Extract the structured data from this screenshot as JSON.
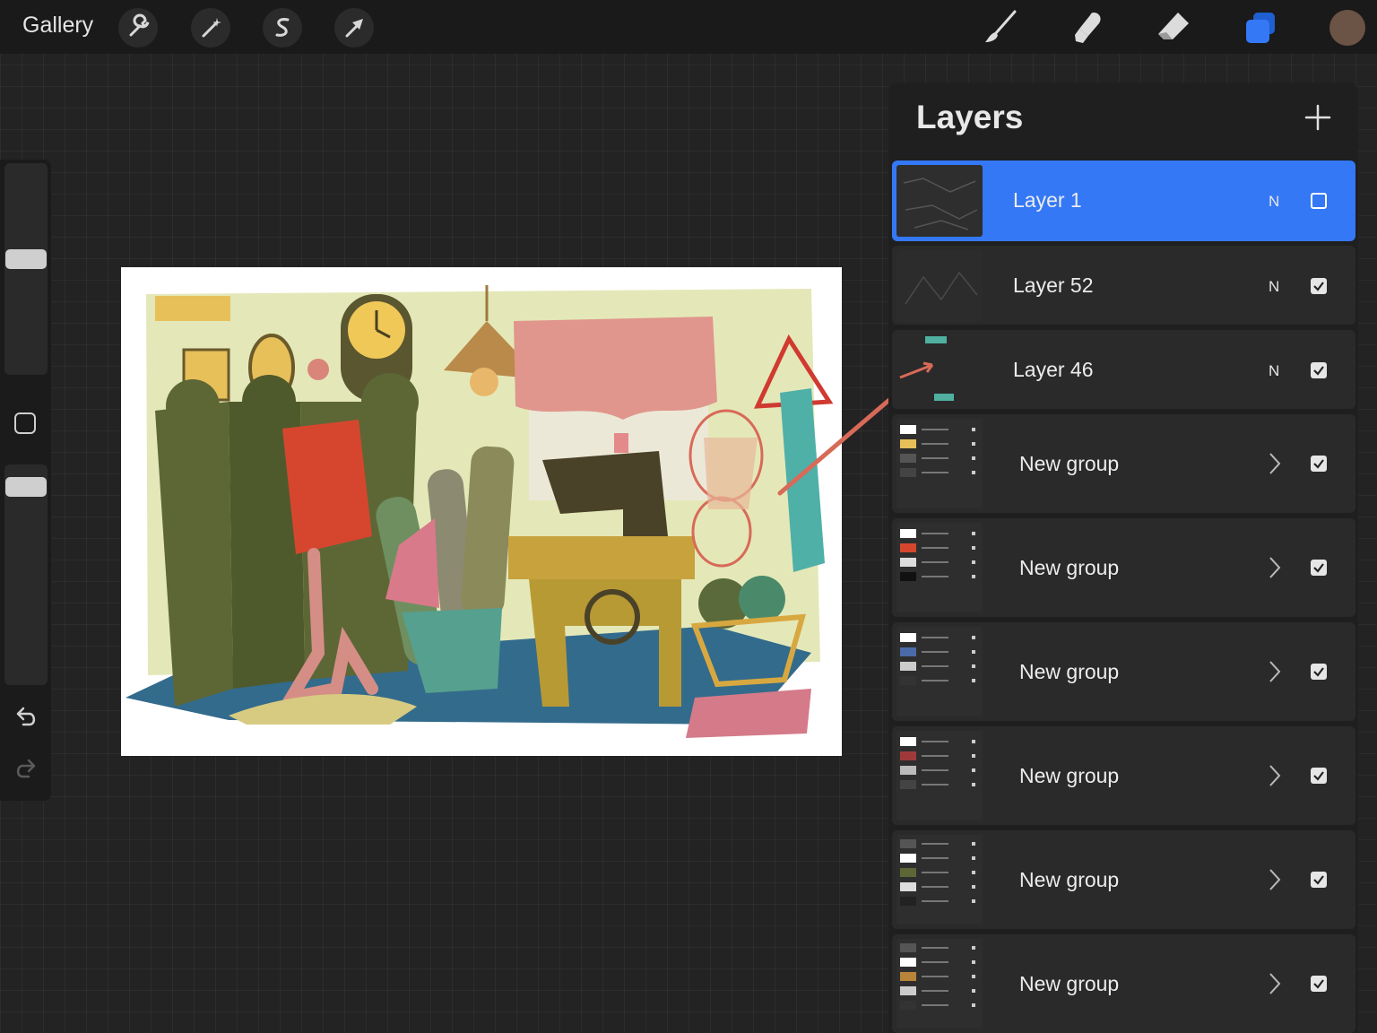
{
  "toolbar": {
    "gallery_label": "Gallery",
    "left_tools": [
      "wrench-icon",
      "magic-wand-icon",
      "selection-icon",
      "transform-arrow-icon"
    ],
    "right_tools": [
      "brush-icon",
      "smudge-icon",
      "eraser-icon",
      "layers-icon"
    ],
    "current_color": "#6b5445",
    "active_color": "#3478f6"
  },
  "sidebar": {
    "controls": [
      "brush-size-slider",
      "modify-square-button",
      "opacity-slider",
      "undo-icon",
      "redo-icon"
    ]
  },
  "layers": {
    "title": "Layers",
    "rows": [
      {
        "name": "Layer 1",
        "blend": "N",
        "visible": false,
        "selected": true
      },
      {
        "name": "Layer 52",
        "blend": "N",
        "visible": true,
        "selected": false
      },
      {
        "name": "Layer 46",
        "blend": "N",
        "visible": true,
        "selected": false
      },
      {
        "name": "New group",
        "visible": true,
        "group": true
      },
      {
        "name": "New group",
        "visible": true,
        "group": true
      },
      {
        "name": "New group",
        "visible": true,
        "group": true
      },
      {
        "name": "New group",
        "visible": true,
        "group": true
      },
      {
        "name": "New group",
        "visible": true,
        "group": true
      },
      {
        "name": "New group",
        "visible": true,
        "group": true
      }
    ]
  }
}
